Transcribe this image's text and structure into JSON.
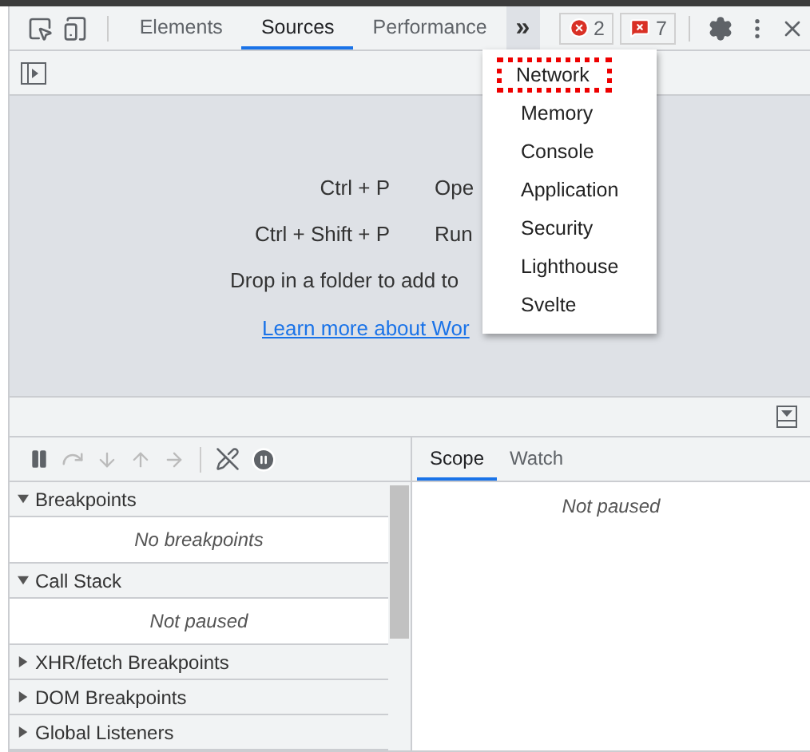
{
  "toolbar": {
    "tabs": [
      {
        "label": "Elements",
        "selected": false
      },
      {
        "label": "Sources",
        "selected": true
      },
      {
        "label": "Performance",
        "selected": false
      }
    ],
    "more": {
      "label": "»",
      "expanded": true
    },
    "counters": [
      {
        "kind": "error",
        "count": "2"
      },
      {
        "kind": "issue",
        "count": "7"
      }
    ]
  },
  "more_menu": {
    "items": [
      {
        "label": "Network",
        "highlighted": true
      },
      {
        "label": "Memory",
        "highlighted": false
      },
      {
        "label": "Console",
        "highlighted": false
      },
      {
        "label": "Application",
        "highlighted": false
      },
      {
        "label": "Security",
        "highlighted": false
      },
      {
        "label": "Lighthouse",
        "highlighted": false
      },
      {
        "label": "Svelte",
        "highlighted": false
      }
    ]
  },
  "workspace": {
    "shortcuts": [
      {
        "keys": "Ctrl + P",
        "action": "Ope"
      },
      {
        "keys": "Ctrl + Shift + P",
        "action": "Run"
      }
    ],
    "drop_hint": "Drop in a folder to add to",
    "link": "Learn more about Wor"
  },
  "debugger": {
    "sections": [
      {
        "title": "Breakpoints",
        "expanded": true,
        "message": "No breakpoints"
      },
      {
        "title": "Call Stack",
        "expanded": true,
        "message": "Not paused"
      },
      {
        "title": "XHR/fetch Breakpoints",
        "expanded": false
      },
      {
        "title": "DOM Breakpoints",
        "expanded": false
      },
      {
        "title": "Global Listeners",
        "expanded": false
      }
    ],
    "side_tabs": [
      {
        "label": "Scope",
        "selected": true
      },
      {
        "label": "Watch",
        "selected": false
      }
    ],
    "side_message": "Not paused"
  }
}
